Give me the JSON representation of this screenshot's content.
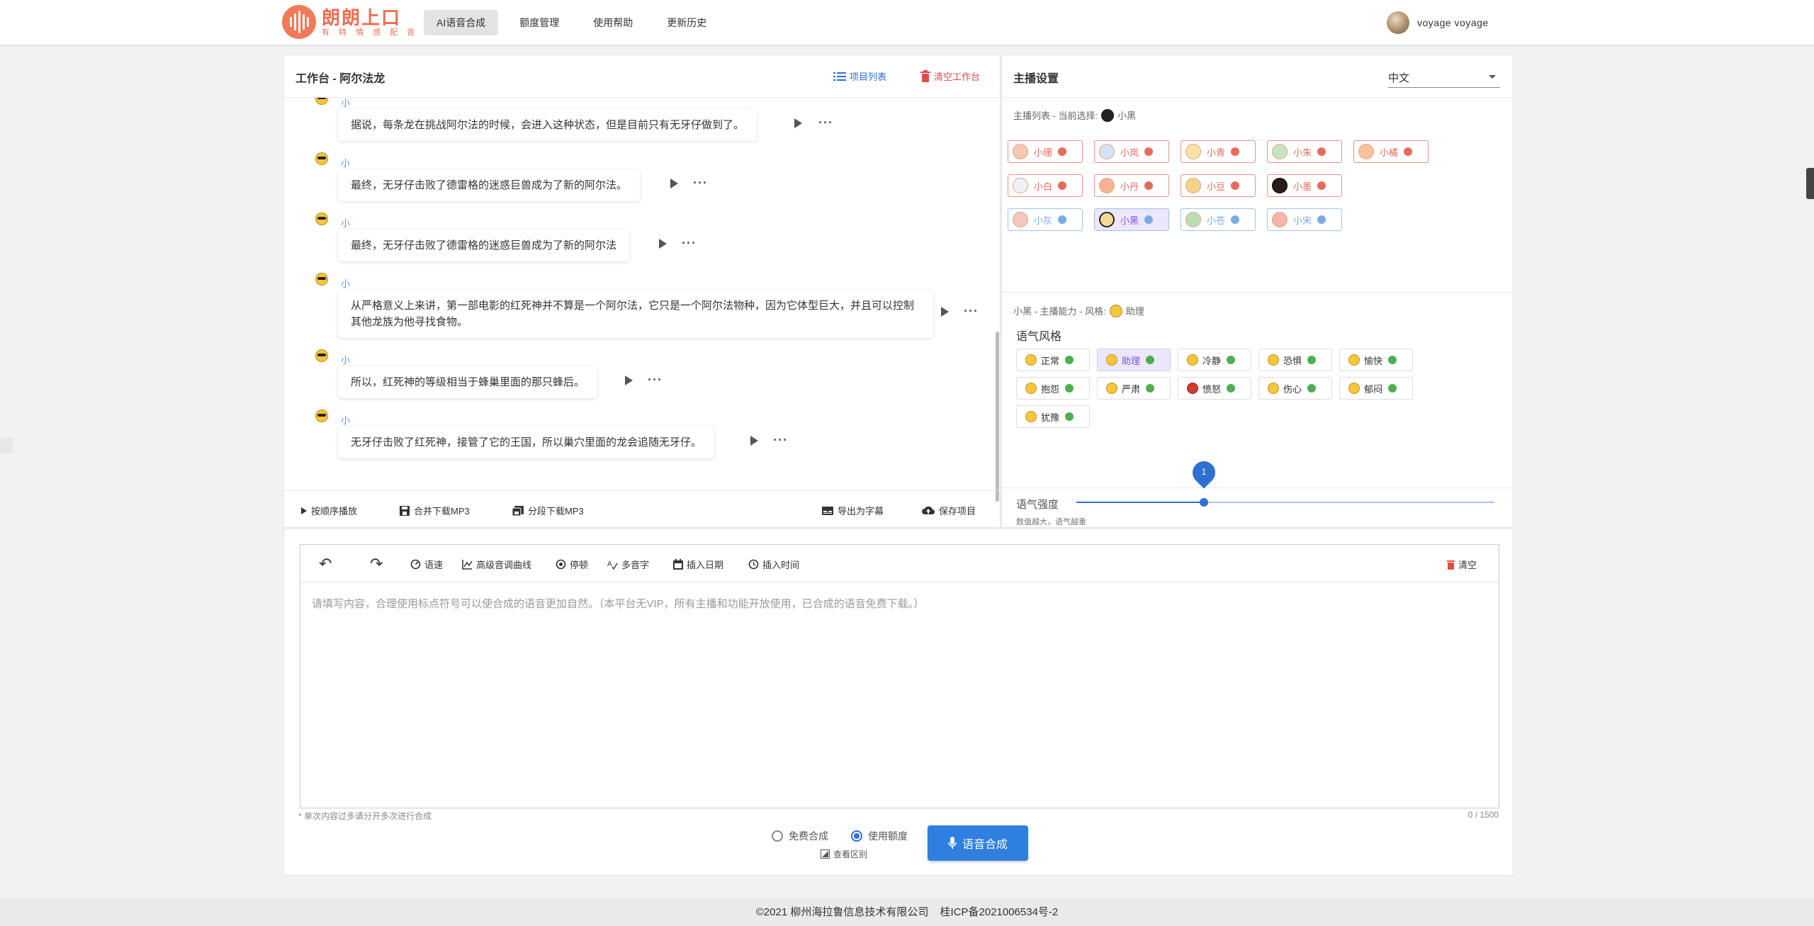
{
  "brand": {
    "title": "朗朗上口",
    "subtitle": "有 特 情 感 配 音",
    "color": "#ef6d52"
  },
  "nav": {
    "items": [
      "AI语音合成",
      "额度管理",
      "使用帮助",
      "更新历史"
    ],
    "active_index": 0
  },
  "user": {
    "name": "voyage voyage"
  },
  "workspace": {
    "title": "工作台 - 阿尔法龙",
    "project_list": "项目列表",
    "clear": "清空工作台",
    "messages": [
      {
        "speaker": "小黑",
        "text": "据说，每条龙在挑战阿尔法的时候，会进入这种状态，但是目前只有无牙仔做到了。"
      },
      {
        "speaker": "小黑",
        "text": "最终，无牙仔击败了德雷格的迷惑巨兽成为了新的阿尔法。"
      },
      {
        "speaker": "小黑",
        "text": "最终，无牙仔击败了德雷格的迷惑巨兽成为了新的阿尔法"
      },
      {
        "speaker": "小黑",
        "text": "从严格意义上来讲，第一部电影的红死神并不算是一个阿尔法，它只是一个阿尔法物种，因为它体型巨大，并且可以控制其他龙族为他寻找食物。"
      },
      {
        "speaker": "小黑",
        "text": "所以，红死神的等级相当于蜂巢里面的那只蜂后。"
      },
      {
        "speaker": "小黑",
        "text": "无牙仔击败了红死神，接管了它的王国，所以巢穴里面的龙会追随无牙仔。"
      }
    ],
    "more_glyph": "···",
    "actions": {
      "play_seq": "按顺序播放",
      "merge_mp3": "合并下载MP3",
      "split_mp3": "分段下载MP3",
      "export_sub": "导出为字幕",
      "save": "保存项目"
    }
  },
  "anchor": {
    "title": "主播设置",
    "language": "中文",
    "list_label": "主播列表 - 当前选择:",
    "current": "小黑",
    "anchors": [
      "小珊",
      "小岚",
      "小青",
      "小朱",
      "小橘",
      "小白",
      "小丹",
      "小豆",
      "小墨",
      "小灰",
      "小黑",
      "小苍",
      "小宋"
    ],
    "ability_label": "小黑 - 主播能力 - 风格:",
    "ability_style": "助理",
    "style_title": "语气风格",
    "styles": [
      "正常",
      "助理",
      "冷静",
      "恐惧",
      "愉快",
      "抱怨",
      "严肃",
      "愤怒",
      "伤心",
      "郁闷",
      "犹豫"
    ],
    "selected_style": "助理",
    "intensity_label": "语气强度",
    "intensity_hint": "数值越大，语气越重",
    "intensity_value": "1",
    "intensity_fraction": 0.305
  },
  "editor": {
    "undo": "↶",
    "redo": "↷",
    "tools": [
      "语速",
      "高级音调曲线",
      "停顿",
      "多音字",
      "插入日期",
      "插入时间"
    ],
    "clear": "清空",
    "placeholder": "请填写内容，合理使用标点符号可以使合成的语音更加自然。（本平台无VIP，所有主播和功能开放使用，已合成的语音免费下载。）",
    "note": "* 单次内容过多请分开多次进行合成",
    "counter": "0 / 1500",
    "mode_free": "免费合成",
    "mode_quota": "使用额度",
    "diff_link": "查看区别",
    "synth": "语音合成"
  },
  "footer": {
    "copyright": "©2021 柳州海拉鲁信息技术有限公司",
    "icp": "桂ICP备2021006534号-2"
  },
  "colors": {
    "accent": "#2f6fd4",
    "danger": "#e04b4b",
    "brand": "#ef6d52"
  }
}
